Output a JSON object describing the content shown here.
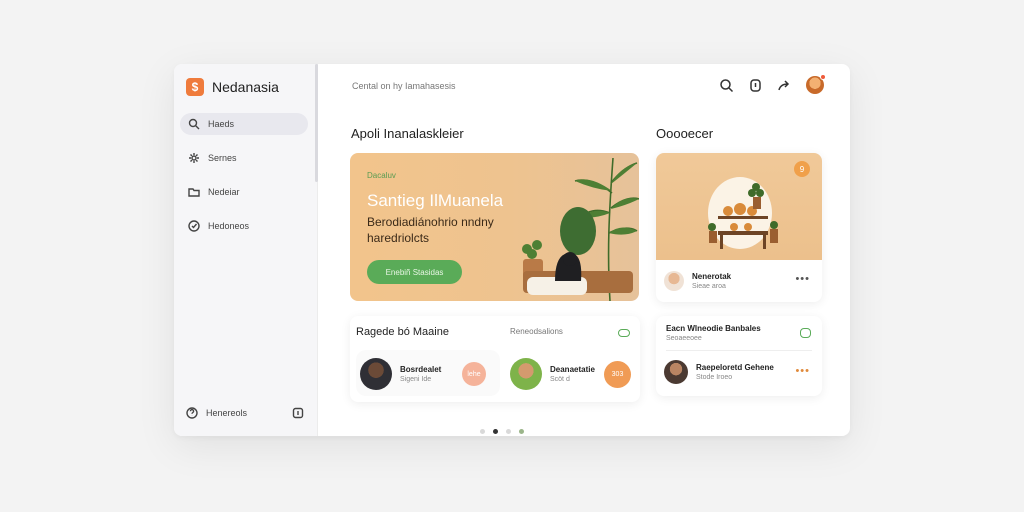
{
  "app": {
    "name": "Nedanasia",
    "logo_glyph": "$"
  },
  "sidebar": {
    "items": [
      {
        "label": "Haeds",
        "icon": "search-icon",
        "active": true
      },
      {
        "label": "Sernes",
        "icon": "settings-icon",
        "active": false
      },
      {
        "label": "Nedeiar",
        "icon": "folder-icon",
        "active": false
      },
      {
        "label": "Hedoneos",
        "icon": "check-circle-icon",
        "active": false
      }
    ],
    "bottom": {
      "label": "Henereols",
      "icon": "help-icon",
      "right_icon": "square-icon"
    }
  },
  "topbar": {
    "breadcrumb": "Cental on hy Iamahasesis",
    "icons": [
      "search-icon",
      "clipboard-icon",
      "share-icon",
      "avatar"
    ]
  },
  "main": {
    "section_title": "Apoli Inanalaskleier",
    "hero": {
      "tag": "Dacaluv",
      "title": "Santieg IlMuanela",
      "subtitle": "Berodiadiánohrio nndny haredriolcts",
      "button": "Enebiñ Stasidas"
    }
  },
  "right": {
    "section_title": "Ooooecer",
    "product": {
      "badge": "9",
      "person_name": "Nenerotak",
      "person_meta": "Sieae aroa"
    },
    "news": {
      "title": "Eacn Wlneodie Banbales",
      "meta": "Seoaeeoee",
      "person_name": "Raepeloretd Gehene",
      "person_meta": "Stode Iroeo"
    }
  },
  "recommendations": {
    "title": "Ragede bó Maaine",
    "subtitle": "Reneodsalions",
    "people": [
      {
        "name": "Bosrdealet",
        "meta": "Sigeni Ide",
        "badge": "lehe"
      },
      {
        "name": "Deanaetatie",
        "meta": "Scöt  d",
        "badge": "303"
      }
    ]
  },
  "colors": {
    "accent": "#ef7b3c",
    "green": "#5aab58",
    "hero_bg": "#f0c48c"
  }
}
